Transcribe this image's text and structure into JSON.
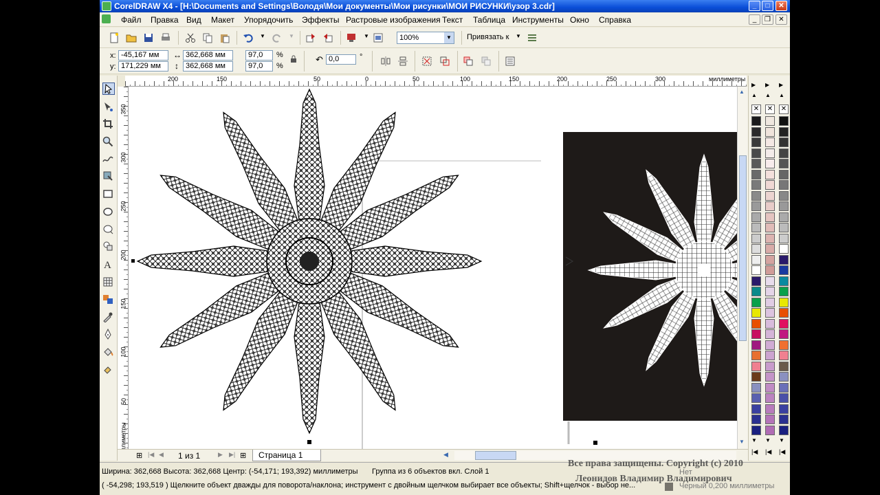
{
  "titlebar": {
    "title": "CorelDRAW X4 - [H:\\Documents and Settings\\Володя\\Мои документы\\Мои рисунки\\МОИ РИСУНКИ\\узор 3.cdr]"
  },
  "menu": [
    "Файл",
    "Правка",
    "Вид",
    "Макет",
    "Упорядочить",
    "Эффекты",
    "Растровые изображения",
    "Текст",
    "Таблица",
    "Инструменты",
    "Окно",
    "Справка"
  ],
  "toolbar": {
    "zoom_value": "100%",
    "snap_label": "Привязать к"
  },
  "property_bar": {
    "x_label": "x:",
    "y_label": "y:",
    "x_value": "-45,167 мм",
    "y_value": "171,229 мм",
    "width_value": "362,668 мм",
    "height_value": "362,668 мм",
    "scale_x": "97,0",
    "scale_y": "97,0",
    "percent": "%",
    "rotation_value": "0,0",
    "degree": "°"
  },
  "ruler_top": {
    "labels": [
      "200",
      "150",
      "50",
      "0",
      "50",
      "100",
      "150",
      "200",
      "250",
      "300"
    ],
    "units": "миллиметры"
  },
  "ruler_left": {
    "labels": [
      "350",
      "300",
      "250",
      "200",
      "150",
      "100",
      "50"
    ],
    "units": "миллиметры"
  },
  "page_nav": {
    "page_count": "1 из 1",
    "tab": "Страница 1"
  },
  "status": {
    "line1_dims": "Ширина: 362,668  Высота: 362,668  Центр: (-54,171; 193,392)  миллиметры",
    "line1_info": "Группа из 6 объектов вкл. Слой 1",
    "line2": "( -54,298; 193,519 )     Щелкните объект дважды для поворота/наклона; инструмент с двойным щелчком выбирает все объекты; Shift+щелчок - выбор не...",
    "fill_label": "Нет",
    "outline_label": "Черный  0,200 миллиметры"
  },
  "watermark": {
    "line1": "Все права защищены. Copyright (c) 2010",
    "line2": "Леонидов Владимир Владимирович"
  },
  "palette": {
    "col1": [
      "#1a1a1a",
      "#2a2a2a",
      "#3a3a3a",
      "#4a4a4a",
      "#5a5a5a",
      "#6a6a6a",
      "#7a7a7a",
      "#8a8a8a",
      "#9a9a9a",
      "#aaaaaa",
      "#bbbbbb",
      "#cccccc",
      "#dddddd",
      "#eeeeee",
      "#ffffff",
      "#2a1a6a",
      "#0a8a8a",
      "#0aa04a",
      "#e8e800",
      "#e85000",
      "#c81060",
      "#a01880",
      "#e87030",
      "#f08090",
      "#6a3a1a",
      "#8a90c0",
      "#5a60b0",
      "#3a40a0",
      "#2a3090",
      "#1a2080"
    ],
    "col2": [
      "#f0e8e0",
      "#f0e4dc",
      "#f4e8e4",
      "#f4ecea",
      "#f8ecec",
      "#f4e0dc",
      "#f0d8d4",
      "#ecd4d0",
      "#e8ccc8",
      "#e4c4c0",
      "#e0bcb8",
      "#dcb4b0",
      "#d8aca8",
      "#d4a4a0",
      "#d09c98",
      "#e8dcec",
      "#e4d4e8",
      "#e0cce4",
      "#dcc4e0",
      "#d8bcdc",
      "#d4b4d8",
      "#d0acd4",
      "#cca4d0",
      "#c89ccc",
      "#c494c8",
      "#c08cc4",
      "#bc84c0",
      "#b87cbc",
      "#b474b8",
      "#b06cb4"
    ],
    "col3": [
      "#111111",
      "#222222",
      "#333333",
      "#444444",
      "#555555",
      "#666666",
      "#777777",
      "#888888",
      "#999999",
      "#aaaaaa",
      "#bbbbbb",
      "#cccccc",
      "#ffffff",
      "#2a1a6a",
      "#1a3aa0",
      "#0a8aa0",
      "#0aa04a",
      "#e8e800",
      "#e85000",
      "#e01060",
      "#c01880",
      "#f07030",
      "#f08090",
      "#6a5a4a",
      "#8a90c0",
      "#6a70b8",
      "#4a50a8",
      "#3a40a0",
      "#2a3090",
      "#1a2080"
    ]
  }
}
